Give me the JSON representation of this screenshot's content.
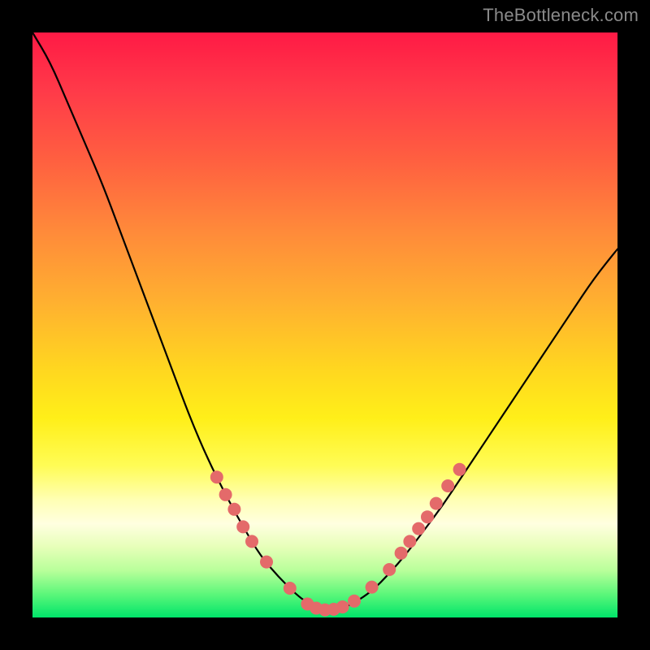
{
  "watermark": "TheBottleneck.com",
  "colors": {
    "background": "#000000",
    "curve_stroke": "#000000",
    "dot_fill": "#e46a6a",
    "gradient_top": "#ff1a45",
    "gradient_bottom": "#00e46a"
  },
  "chart_data": {
    "type": "line",
    "title": "",
    "xlabel": "",
    "ylabel": "",
    "xlim": [
      0,
      100
    ],
    "ylim": [
      0,
      100
    ],
    "grid": false,
    "series": [
      {
        "name": "bottleneck-curve",
        "x": [
          0,
          3,
          6,
          9,
          12,
          15,
          18,
          21,
          24,
          27,
          30,
          33,
          36,
          39,
          42,
          45,
          47,
          49,
          51,
          53,
          55,
          58,
          61,
          64,
          67,
          70,
          73,
          76,
          80,
          84,
          88,
          92,
          96,
          100
        ],
        "y": [
          100,
          95,
          88,
          81,
          74,
          66,
          58,
          50,
          42,
          34,
          27,
          21,
          15.5,
          10.5,
          7,
          4,
          2.5,
          1.6,
          1.3,
          1.6,
          2.5,
          4.5,
          7.5,
          11,
          15,
          19,
          23.5,
          28,
          34,
          40,
          46,
          52,
          58,
          63
        ]
      }
    ],
    "dots": [
      {
        "x": 31.5,
        "y": 24
      },
      {
        "x": 33,
        "y": 21
      },
      {
        "x": 34.5,
        "y": 18.5
      },
      {
        "x": 36,
        "y": 15.5
      },
      {
        "x": 37.5,
        "y": 13
      },
      {
        "x": 40,
        "y": 9.5
      },
      {
        "x": 44,
        "y": 5
      },
      {
        "x": 47,
        "y": 2.3
      },
      {
        "x": 48.5,
        "y": 1.6
      },
      {
        "x": 50,
        "y": 1.3
      },
      {
        "x": 51.5,
        "y": 1.4
      },
      {
        "x": 53,
        "y": 1.8
      },
      {
        "x": 55,
        "y": 2.8
      },
      {
        "x": 58,
        "y": 5.2
      },
      {
        "x": 61,
        "y": 8.2
      },
      {
        "x": 63,
        "y": 11
      },
      {
        "x": 64.5,
        "y": 13
      },
      {
        "x": 66,
        "y": 15.2
      },
      {
        "x": 67.5,
        "y": 17.2
      },
      {
        "x": 69,
        "y": 19.5
      },
      {
        "x": 71,
        "y": 22.5
      },
      {
        "x": 73,
        "y": 25.3
      }
    ]
  }
}
